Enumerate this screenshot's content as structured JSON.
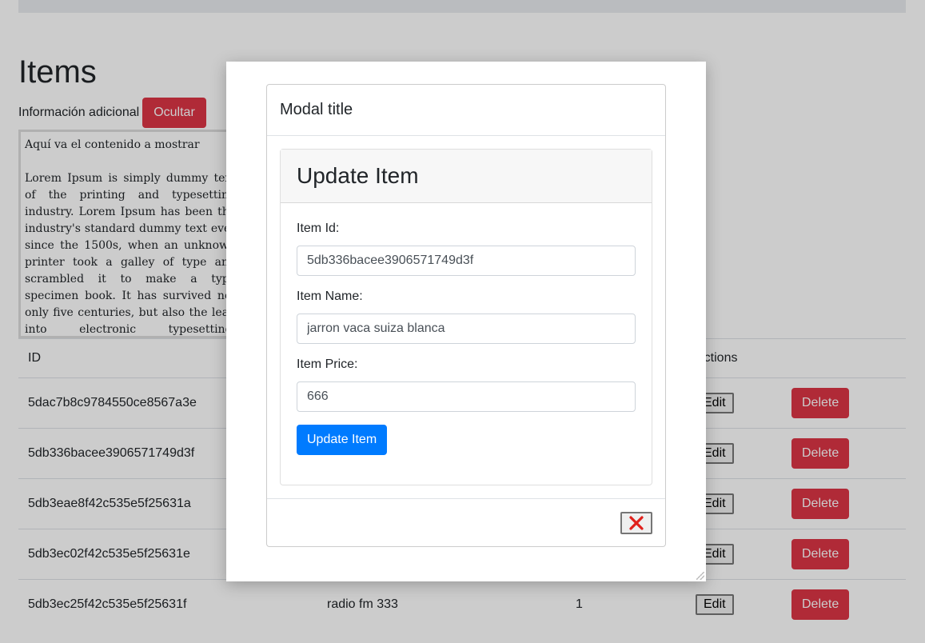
{
  "page": {
    "title": "Items",
    "info_label": "Información adicional",
    "toggle_button": "Ocultar",
    "info_heading": "Aquí va el contenido a mostrar",
    "info_text": "Lorem Ipsum is simply dummy text of the printing and typesetting industry. Lorem Ipsum has been the industry's standard dummy text ever since the 1500s, when an unknown printer took a galley of type and scrambled it to make a type specimen book. It has survived not only five centuries, but also the leap into electronic typesetting, remaining essentially unchanged. It was popularised in the 1960s with the release of Letraset sheets containing Lorem Ipsum passages"
  },
  "table": {
    "headers": {
      "id": "ID",
      "actions": "Actions"
    },
    "edit_label": "Edit",
    "delete_label": "Delete",
    "rows": [
      {
        "id": "5dac7b8c9784550ce8567a3e",
        "name": "",
        "price": ""
      },
      {
        "id": "5db336bacee3906571749d3f",
        "name": "",
        "price": ""
      },
      {
        "id": "5db3eae8f42c535e5f25631a",
        "name": "",
        "price": ""
      },
      {
        "id": "5db3ec02f42c535e5f25631e",
        "name": "",
        "price": ""
      },
      {
        "id": "5db3ec25f42c535e5f25631f",
        "name": "radio fm 333",
        "price": "1"
      }
    ]
  },
  "modal": {
    "title": "Modal title",
    "card_title": "Update Item",
    "fields": {
      "id_label": "Item Id:",
      "id_value": "5db336bacee3906571749d3f",
      "name_label": "Item Name:",
      "name_value": "jarron vaca suiza blanca",
      "price_label": "Item Price:",
      "price_value": "666"
    },
    "submit_label": "Update Item",
    "close_icon": "close-x-icon"
  },
  "colors": {
    "danger": "#dc3545",
    "primary": "#007bff",
    "overlay": "rgba(0,0,0,0.2)",
    "close_x": "#e0201b"
  }
}
